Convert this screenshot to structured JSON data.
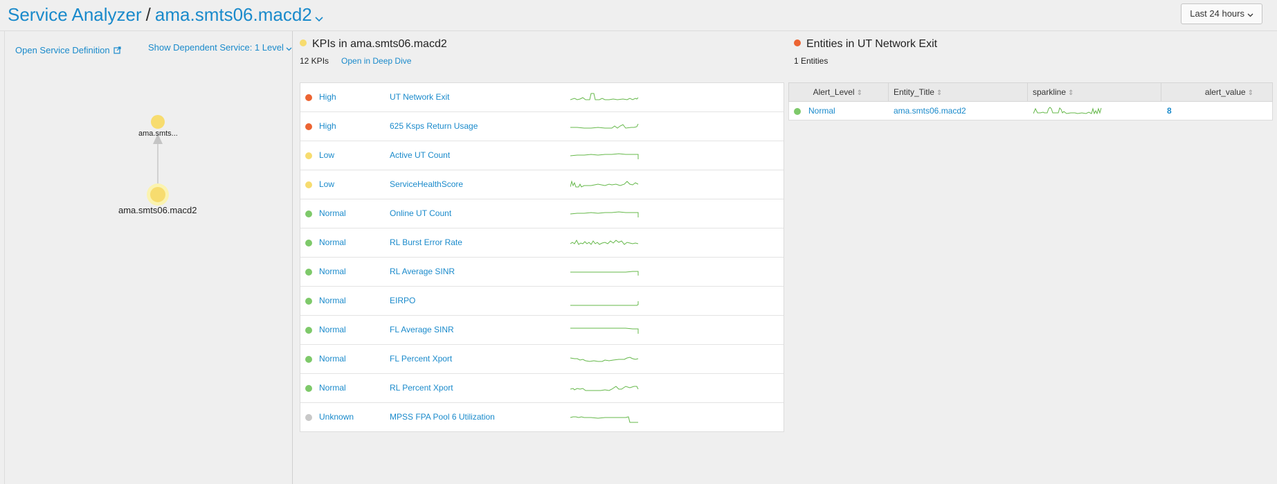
{
  "header": {
    "app_title": "Service Analyzer",
    "separator": "/",
    "service_name": "ama.smts06.macd2",
    "time_range": "Last 24 hours"
  },
  "left_panel": {
    "open_service_definition": "Open Service Definition",
    "show_dependent_service": "Show Dependent Service:  1 Level",
    "nodes": [
      {
        "label": "ama.smts...",
        "color": "#f7dc6f"
      },
      {
        "label": "ama.smts06.macd2",
        "color": "#f7dc6f"
      }
    ]
  },
  "kpi_panel": {
    "title": "KPIs in ama.smts06.macd2",
    "title_dot_color": "#f7dc6f",
    "count": "12 KPIs",
    "deep_dive_link": "Open in Deep Dive",
    "kpis": [
      {
        "level": "High",
        "color": "#ec6432",
        "name": "UT Network Exit"
      },
      {
        "level": "High",
        "color": "#ec6432",
        "name": "625 Ksps Return Usage"
      },
      {
        "level": "Low",
        "color": "#f7dc6f",
        "name": "Active UT Count"
      },
      {
        "level": "Low",
        "color": "#f7dc6f",
        "name": "ServiceHealthScore"
      },
      {
        "level": "Normal",
        "color": "#7ec96a",
        "name": "Online UT Count"
      },
      {
        "level": "Normal",
        "color": "#7ec96a",
        "name": "RL Burst Error Rate"
      },
      {
        "level": "Normal",
        "color": "#7ec96a",
        "name": "RL Average SINR"
      },
      {
        "level": "Normal",
        "color": "#7ec96a",
        "name": "EIRPO"
      },
      {
        "level": "Normal",
        "color": "#7ec96a",
        "name": "FL Average SINR"
      },
      {
        "level": "Normal",
        "color": "#7ec96a",
        "name": "FL Percent Xport"
      },
      {
        "level": "Normal",
        "color": "#7ec96a",
        "name": "RL Percent Xport"
      },
      {
        "level": "Unknown",
        "color": "#c8c8c8",
        "name": "MPSS FPA Pool 6 Utilization"
      }
    ]
  },
  "entities_panel": {
    "title": "Entities in UT Network Exit",
    "title_dot_color": "#ec6432",
    "count": "1 Entities",
    "columns": [
      "Alert_Level",
      "Entity_Title",
      "sparkline",
      "alert_value"
    ],
    "rows": [
      {
        "alert_level": "Normal",
        "color": "#7ec96a",
        "entity_title": "ama.smts06.macd2",
        "alert_value": "8"
      }
    ]
  },
  "colors": {
    "link": "#1a8acb",
    "sparkline": "#65b84a",
    "high": "#ec6432",
    "low": "#f7dc6f",
    "normal": "#7ec96a",
    "unknown": "#c8c8c8"
  }
}
